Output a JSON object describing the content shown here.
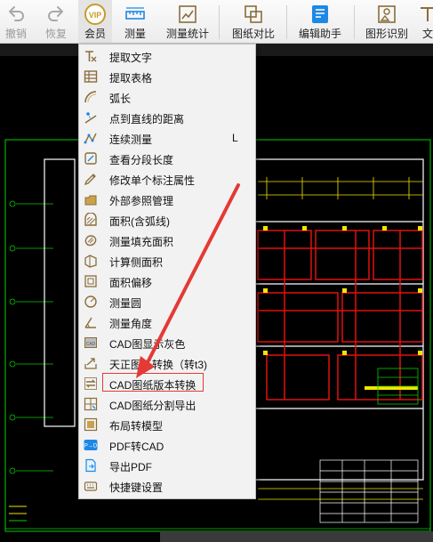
{
  "toolbar": {
    "buttons": [
      {
        "label": "撤销",
        "icon": "undo-icon",
        "state": "disabled"
      },
      {
        "label": "恢复",
        "icon": "redo-icon",
        "state": "disabled"
      },
      {
        "label": "会员",
        "icon": "vip-icon",
        "badge": "VIP",
        "state": "active"
      },
      {
        "label": "测量",
        "icon": "ruler-icon"
      },
      {
        "label": "测量统计",
        "icon": "measure-stats-icon"
      },
      {
        "label": "图纸对比",
        "icon": "compare-icon"
      },
      {
        "label": "编辑助手",
        "icon": "edit-assistant-icon"
      },
      {
        "label": "图形识别",
        "icon": "shape-recognition-icon"
      },
      {
        "label": "文",
        "icon": "text-icon"
      }
    ]
  },
  "menu": {
    "items": [
      {
        "label": "提取文字",
        "icon": "extract-text-icon"
      },
      {
        "label": "提取表格",
        "icon": "extract-table-icon"
      },
      {
        "label": "弧长",
        "icon": "arc-length-icon"
      },
      {
        "label": "点到直线的距离",
        "icon": "point-line-distance-icon"
      },
      {
        "label": "连续测量",
        "icon": "continuous-measure-icon",
        "shortcut": "L"
      },
      {
        "label": "查看分段长度",
        "icon": "segment-length-icon"
      },
      {
        "label": "修改单个标注属性",
        "icon": "edit-dimension-icon"
      },
      {
        "label": "外部参照管理",
        "icon": "xref-icon"
      },
      {
        "label": "面积(含弧线)",
        "icon": "area-arc-icon"
      },
      {
        "label": "测量填充面积",
        "icon": "fill-area-icon"
      },
      {
        "label": "计算侧面积",
        "icon": "side-area-icon"
      },
      {
        "label": "面积偏移",
        "icon": "area-offset-icon"
      },
      {
        "label": "测量圆",
        "icon": "circle-measure-icon"
      },
      {
        "label": "测量角度",
        "icon": "angle-icon"
      },
      {
        "label": "CAD图显示灰色",
        "icon": "gray-display-icon"
      },
      {
        "label": "天正图纸转换（转t3)",
        "icon": "tangent-convert-icon"
      },
      {
        "label": "CAD图纸版本转换",
        "icon": "version-convert-icon",
        "highlighted": true
      },
      {
        "label": "CAD图纸分割导出",
        "icon": "split-export-icon"
      },
      {
        "label": "布局转模型",
        "icon": "layout-model-icon"
      },
      {
        "label": "PDF转CAD",
        "icon": "pdf-cad-icon",
        "badge": "P→D"
      },
      {
        "label": "导出PDF",
        "icon": "export-pdf-icon"
      },
      {
        "label": "快捷键设置",
        "icon": "shortcut-settings-icon"
      }
    ]
  },
  "colors": {
    "toolbar_bg": "#f3f3f3",
    "menu_bg": "#f2f2f2",
    "canvas_bg": "#000000",
    "icon_blue": "#1e88e5",
    "icon_brown": "#8a6d3b",
    "highlight": "#e53935",
    "cad_red": "#e01010",
    "cad_yellow": "#f2e600",
    "cad_green": "#00d000",
    "cad_white": "#ffffff"
  }
}
